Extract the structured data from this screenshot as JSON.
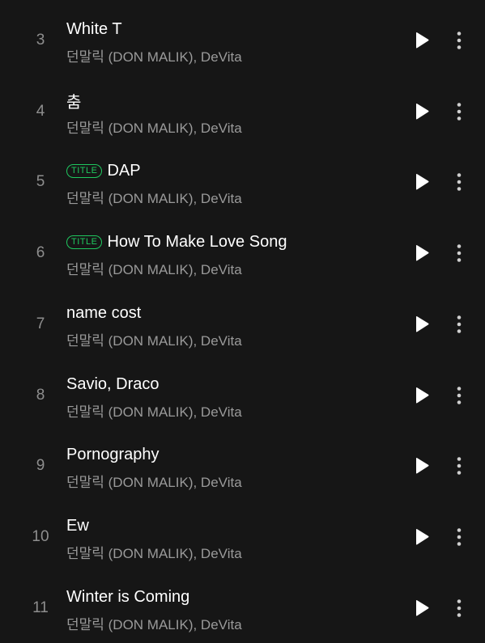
{
  "tracks": [
    {
      "number": "3",
      "title": "White T",
      "artist": "던말릭 (DON MALIK), DeVita",
      "badge": ""
    },
    {
      "number": "4",
      "title": "춤",
      "artist": "던말릭 (DON MALIK), DeVita",
      "badge": ""
    },
    {
      "number": "5",
      "title": "DAP",
      "artist": "던말릭 (DON MALIK), DeVita",
      "badge": "TITLE"
    },
    {
      "number": "6",
      "title": "How To Make Love Song",
      "artist": "던말릭 (DON MALIK), DeVita",
      "badge": "TITLE"
    },
    {
      "number": "7",
      "title": "name cost",
      "artist": "던말릭 (DON MALIK), DeVita",
      "badge": ""
    },
    {
      "number": "8",
      "title": "Savio, Draco",
      "artist": "던말릭 (DON MALIK), DeVita",
      "badge": ""
    },
    {
      "number": "9",
      "title": "Pornography",
      "artist": "던말릭 (DON MALIK), DeVita",
      "badge": ""
    },
    {
      "number": "10",
      "title": "Ew",
      "artist": "던말릭 (DON MALIK), DeVita",
      "badge": ""
    },
    {
      "number": "11",
      "title": "Winter is Coming",
      "artist": "던말릭 (DON MALIK), DeVita",
      "badge": ""
    }
  ],
  "icons": {
    "play": "play-icon",
    "more": "more-vertical-icon"
  },
  "colors": {
    "background": "#161616",
    "badge": "#1fc85f",
    "artist_text": "#9a9a9a",
    "number_text": "#8e8e8e"
  }
}
